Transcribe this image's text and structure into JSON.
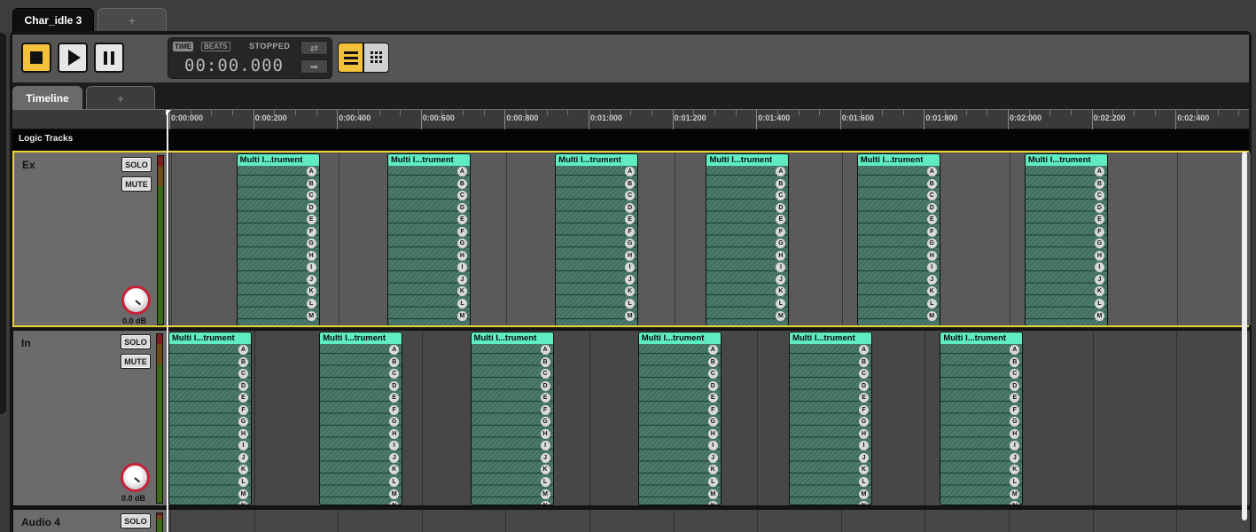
{
  "document_tabs": {
    "active": "Char_idle 3",
    "add": "+"
  },
  "transport": {
    "mode_time": "TIME",
    "mode_beats": "BEATS",
    "status": "STOPPED",
    "time_value": "00:00.000",
    "loop_icon": "loop-icon",
    "follow_icon": "follow-arrow-icon",
    "stop_icon": "stop-icon",
    "play_icon": "play-icon",
    "pause_icon": "pause-icon",
    "accent_color": "#f2c23a"
  },
  "view_buttons": {
    "list_icon": "list-view-icon",
    "grid_icon": "grid-view-icon"
  },
  "timeline_tabs": {
    "active": "Timeline",
    "add": "+"
  },
  "ruler": {
    "labels": [
      "0:00:000",
      "0:00:200",
      "0:00:400",
      "0:00:600",
      "0:00:800",
      "0:01:000",
      "0:01:200",
      "0:01:400",
      "0:01:600",
      "0:01:800",
      "0:02:000",
      "0:02:200",
      "0:02:400"
    ]
  },
  "logic_tracks": {
    "label": "Logic Tracks"
  },
  "clip_letters": [
    "A",
    "B",
    "C",
    "D",
    "E",
    "F",
    "G",
    "H",
    "I",
    "J",
    "K",
    "L",
    "M",
    "N"
  ],
  "clip_color": "#5eecc0",
  "tracks": [
    {
      "name": "Ex",
      "solo": "SOLO",
      "mute": "MUTE",
      "gain": "0.0 dB",
      "selected": true,
      "clip_title": "Multi I...trument",
      "clip_starts": [
        0.4,
        1.3,
        2.3,
        3.2,
        4.1,
        5.1
      ],
      "clip_letters": 13
    },
    {
      "name": "In",
      "solo": "SOLO",
      "mute": "MUTE",
      "gain": "0.0 dB",
      "selected": false,
      "clip_title": "Multi I...trument",
      "clip_starts": [
        0.0,
        0.9,
        1.8,
        2.8,
        3.7,
        4.6
      ],
      "clip_letters": 14
    },
    {
      "name": "Audio 4",
      "solo": "SOLO",
      "selected": false
    }
  ]
}
